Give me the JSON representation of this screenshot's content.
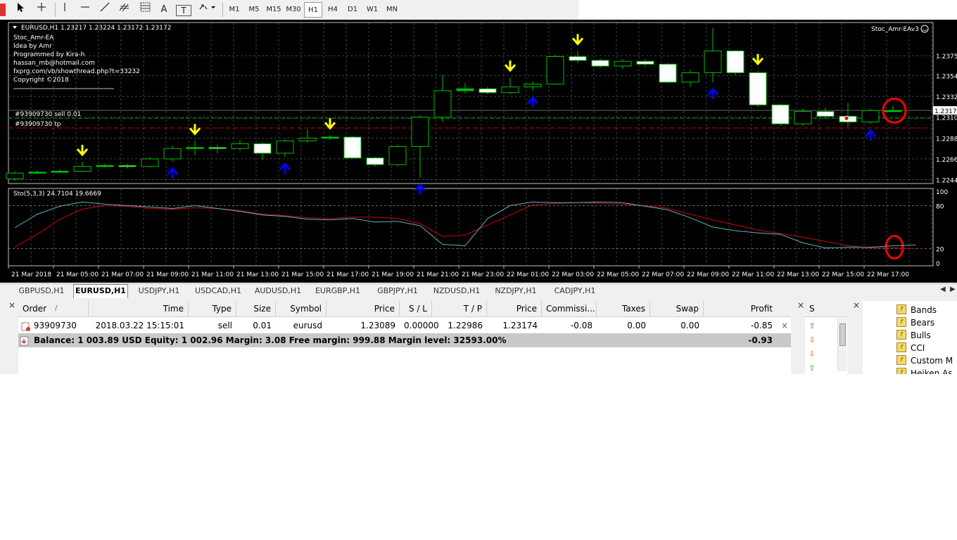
{
  "toolbar": {
    "timeframes": [
      "M1",
      "M5",
      "M15",
      "M30",
      "H1",
      "H4",
      "D1",
      "W1",
      "MN"
    ],
    "active_timeframe": "H1",
    "text_tool": "A",
    "text_label_tool": "T"
  },
  "chart": {
    "symbol_header": "EURUSD,H1  1.23217 1.23224 1.23172 1.23172",
    "ea_name": "Stoc_Amr-EAv3",
    "info_lines": [
      "Stoc_Amr-EA",
      "Idea by Amr",
      "Programmed by Kira-h",
      "hassan_mb@hotmail.com",
      "fxprg.com/vb/showthread.php?t=33232",
      "Copyright ©2018"
    ],
    "order_line_label": "#93909730 sell 0.01",
    "tp_line_label": "#93909730 tp",
    "price_axis": [
      "1.23750",
      "1.23540",
      "1.23320",
      "1.23100",
      "1.22880",
      "1.22660",
      "1.22440"
    ],
    "current_price": "1.23172",
    "indicator_label": "Sto(5,3,3) 24.7104 19.6669",
    "indicator_axis": [
      "100",
      "80",
      "20",
      "0"
    ],
    "time_axis": [
      "21 Mar 2018",
      "21 Mar 05:00",
      "21 Mar 07:00",
      "21 Mar 09:00",
      "21 Mar 11:00",
      "21 Mar 13:00",
      "21 Mar 15:00",
      "21 Mar 17:00",
      "21 Mar 19:00",
      "21 Mar 21:00",
      "21 Mar 23:00",
      "22 Mar 01:00",
      "22 Mar 03:00",
      "22 Mar 05:00",
      "22 Mar 07:00",
      "22 Mar 09:00",
      "22 Mar 11:00",
      "22 Mar 13:00",
      "22 Mar 15:00",
      "22 Mar 17:00"
    ],
    "colors": {
      "background": "#000000",
      "bull": "#00c000",
      "bear_fill": "#ffffff",
      "down_arrow": "#ffff00",
      "up_arrow": "#0000ff",
      "main_line": "#5fb0c0",
      "signal_line": "#d00000",
      "highlight": "#ff0000"
    }
  },
  "chart_tabs": [
    "GBPUSD,H1",
    "EURUSD,H1",
    "USDJPY,H1",
    "USDCAD,H1",
    "AUDUSD,H1",
    "EURGBP,H1",
    "GBPJPY,H1",
    "NZDUSD,H1",
    "NZDJPY,H1",
    "CADJPY,H1"
  ],
  "active_chart_tab": "EURUSD,H1",
  "trade": {
    "columns": [
      "Order",
      "/",
      "Time",
      "Type",
      "Size",
      "Symbol",
      "Price",
      "S / L",
      "T / P",
      "Price",
      "Commissi...",
      "Taxes",
      "Swap",
      "Profit"
    ],
    "order": {
      "order": "93909730",
      "time": "2018.03.22 15:15:01",
      "type": "sell",
      "size": "0.01",
      "symbol": "eurusd",
      "price": "1.23089",
      "sl": "0.00000",
      "tp": "1.22986",
      "current_price": "1.23174",
      "commission": "-0.08",
      "taxes": "0.00",
      "swap": "0.00",
      "profit": "-0.85"
    },
    "balance_text": "Balance: 1 003.89 USD  Equity: 1 002.96  Margin: 3.08  Free margin: 999.88  Margin level: 32593.00%",
    "total_profit": "-0.93"
  },
  "signals_header": "S",
  "navigator_items": [
    "Bands",
    "Bears",
    "Bulls",
    "CCI",
    "Custom M",
    "Heiken As"
  ],
  "close_glyph": "×",
  "fx_glyph": "f",
  "candles": [
    {
      "o": 1.2245,
      "c": 1.2251,
      "h": 1.2253,
      "l": 1.2243
    },
    {
      "o": 1.2251,
      "c": 1.2252,
      "h": 1.2254,
      "l": 1.225
    },
    {
      "o": 1.2252,
      "c": 1.2253,
      "h": 1.2255,
      "l": 1.2251
    },
    {
      "o": 1.2253,
      "c": 1.2258,
      "h": 1.2263,
      "l": 1.2252
    },
    {
      "o": 1.2258,
      "c": 1.2259,
      "h": 1.2261,
      "l": 1.2257
    },
    {
      "o": 1.2259,
      "c": 1.2258,
      "h": 1.2261,
      "l": 1.2256
    },
    {
      "o": 1.2258,
      "c": 1.2266,
      "h": 1.2268,
      "l": 1.2257
    },
    {
      "o": 1.2266,
      "c": 1.2277,
      "h": 1.228,
      "l": 1.2263
    },
    {
      "o": 1.2277,
      "c": 1.2278,
      "h": 1.2285,
      "l": 1.227
    },
    {
      "o": 1.2278,
      "c": 1.2277,
      "h": 1.2281,
      "l": 1.2272
    },
    {
      "o": 1.2277,
      "c": 1.2282,
      "h": 1.2286,
      "l": 1.2275
    },
    {
      "o": 1.2282,
      "c": 1.2272,
      "h": 1.2284,
      "l": 1.2265
    },
    {
      "o": 1.2272,
      "c": 1.2285,
      "h": 1.2287,
      "l": 1.2268
    },
    {
      "o": 1.2285,
      "c": 1.2288,
      "h": 1.2297,
      "l": 1.2283
    },
    {
      "o": 1.2288,
      "c": 1.2289,
      "h": 1.2291,
      "l": 1.2286
    },
    {
      "o": 1.2289,
      "c": 1.2267,
      "h": 1.229,
      "l": 1.2266
    },
    {
      "o": 1.2267,
      "c": 1.226,
      "h": 1.2268,
      "l": 1.2258
    },
    {
      "o": 1.226,
      "c": 1.2279,
      "h": 1.2281,
      "l": 1.2258
    },
    {
      "o": 1.2279,
      "c": 1.231,
      "h": 1.2312,
      "l": 1.2246
    },
    {
      "o": 1.231,
      "c": 1.2338,
      "h": 1.2355,
      "l": 1.2305
    },
    {
      "o": 1.2338,
      "c": 1.234,
      "h": 1.2346,
      "l": 1.2335
    },
    {
      "o": 1.234,
      "c": 1.2336,
      "h": 1.2342,
      "l": 1.2334
    },
    {
      "o": 1.2336,
      "c": 1.2342,
      "h": 1.2352,
      "l": 1.2334
    },
    {
      "o": 1.2342,
      "c": 1.2345,
      "h": 1.2348,
      "l": 1.2338
    },
    {
      "o": 1.2345,
      "c": 1.2374,
      "h": 1.2376,
      "l": 1.2344
    },
    {
      "o": 1.2374,
      "c": 1.237,
      "h": 1.238,
      "l": 1.2367
    },
    {
      "o": 1.237,
      "c": 1.2364,
      "h": 1.2372,
      "l": 1.2362
    },
    {
      "o": 1.2364,
      "c": 1.2369,
      "h": 1.2371,
      "l": 1.2361
    },
    {
      "o": 1.2369,
      "c": 1.2366,
      "h": 1.2371,
      "l": 1.2363
    },
    {
      "o": 1.2366,
      "c": 1.2347,
      "h": 1.2367,
      "l": 1.2346
    },
    {
      "o": 1.2347,
      "c": 1.2357,
      "h": 1.236,
      "l": 1.2342
    },
    {
      "o": 1.2357,
      "c": 1.238,
      "h": 1.2404,
      "l": 1.2347
    },
    {
      "o": 1.238,
      "c": 1.2357,
      "h": 1.2381,
      "l": 1.2355
    },
    {
      "o": 1.2357,
      "c": 1.2323,
      "h": 1.2359,
      "l": 1.2321
    },
    {
      "o": 1.2323,
      "c": 1.2303,
      "h": 1.2324,
      "l": 1.2301
    },
    {
      "o": 1.2303,
      "c": 1.2316,
      "h": 1.2319,
      "l": 1.2301
    },
    {
      "o": 1.2316,
      "c": 1.2311,
      "h": 1.232,
      "l": 1.2308
    },
    {
      "o": 1.2311,
      "c": 1.2305,
      "h": 1.2325,
      "l": 1.23
    },
    {
      "o": 1.2305,
      "c": 1.2317,
      "h": 1.2319,
      "l": 1.2303
    },
    {
      "o": 1.2317,
      "c": 1.2317,
      "h": 1.2322,
      "l": 1.2317
    }
  ],
  "down_arrow_candles": [
    3,
    8,
    14,
    22,
    25,
    33
  ],
  "up_arrow_candles": [
    7,
    12,
    18,
    23,
    31,
    38
  ],
  "stoch_main": [
    49,
    68,
    79,
    85,
    82,
    80,
    78,
    76,
    80,
    76,
    72,
    67,
    65,
    61,
    60,
    62,
    57,
    58,
    52,
    26,
    24,
    62,
    80,
    85,
    84,
    84,
    85,
    84,
    79,
    74,
    63,
    50,
    45,
    42,
    40,
    28,
    21,
    22,
    22,
    24,
    25
  ],
  "stoch_signal": [
    22,
    40,
    61,
    75,
    80,
    79,
    76,
    75,
    77,
    76,
    73,
    68,
    66,
    63,
    62,
    64,
    64,
    62,
    55,
    37,
    39,
    53,
    67,
    81,
    83,
    84,
    83,
    82,
    80,
    76,
    68,
    60,
    53,
    46,
    41,
    36,
    30,
    24,
    21,
    21,
    20
  ],
  "y_price_min": 1.224,
  "y_price_max": 1.241,
  "order_price": 1.23089,
  "tp_price": 1.22986
}
